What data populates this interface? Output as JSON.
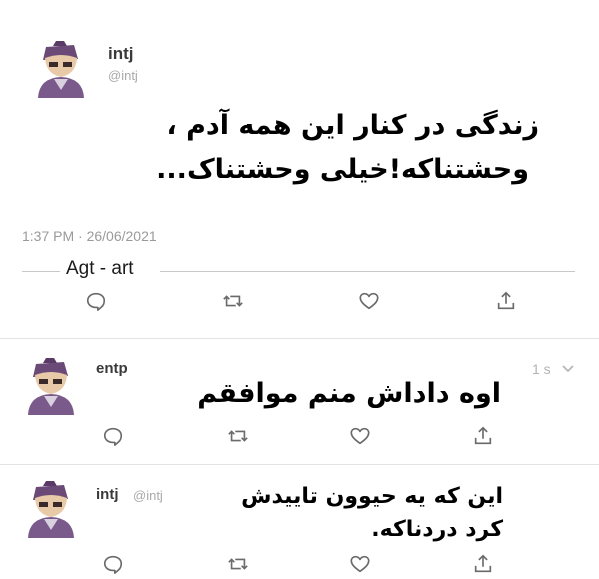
{
  "tweet1": {
    "name": "intj",
    "handle": "@intj",
    "text_line1": "زندگی در کنار این همه آدم ،",
    "text_line2": "وحشتناکه!خیلی وحشتناک...",
    "timestamp": "1:37 PM · 26/06/2021",
    "credit": "Agt - art"
  },
  "reply1": {
    "name": "entp",
    "time": "1 s",
    "text": "اوه داداش منم موافقم"
  },
  "reply2": {
    "name": "intj",
    "handle": "@intj",
    "text_line1": "این که یه حیوون تاییدش",
    "text_line2": "کرد دردناکه."
  },
  "icons": {
    "reply": "reply-icon",
    "retweet": "retweet-icon",
    "like": "heart-icon",
    "share": "share-icon",
    "more": "chevron-down-icon"
  },
  "colors": {
    "text": "#111111",
    "muted": "#9a9a9a",
    "icon": "#6a6a6a",
    "divider": "#e3e3e3"
  }
}
